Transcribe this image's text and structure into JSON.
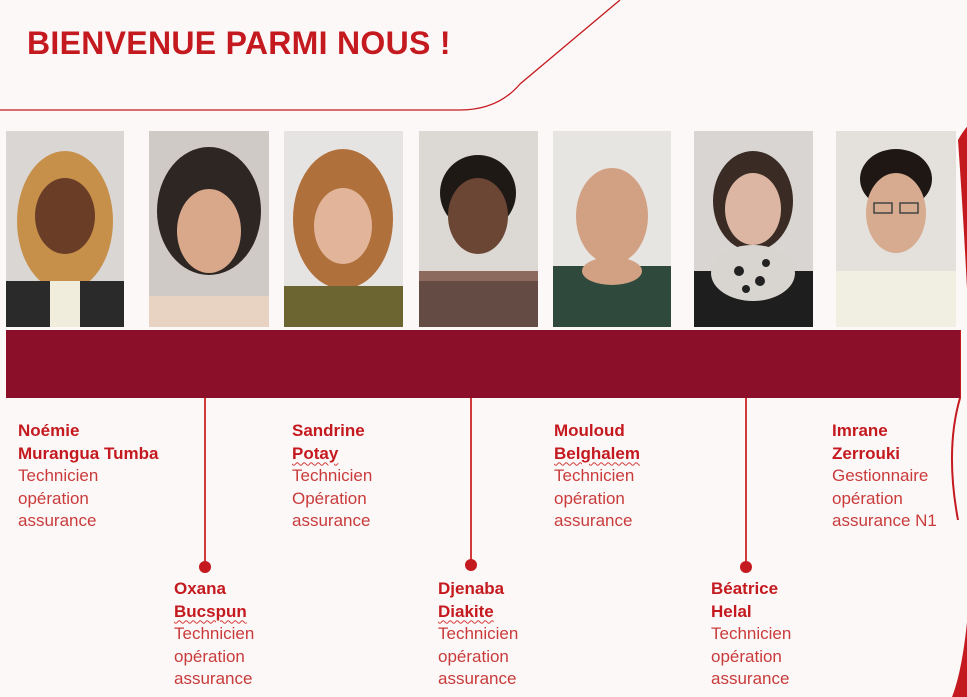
{
  "title": "BIENVENUE PARMI NOUS !",
  "colors": {
    "accent": "#c41a1f",
    "band": "#8b0f29",
    "text_role": "#c93b3b"
  },
  "people": [
    {
      "first_name": "Noémie",
      "last_name": "Murangua Tumba",
      "role": [
        "Technicien",
        "opération",
        "assurance"
      ]
    },
    {
      "first_name": "Oxana",
      "last_name": "Bucspun",
      "role": [
        "Technicien",
        "opération",
        "assurance"
      ]
    },
    {
      "first_name": "Sandrine",
      "last_name": "Potay",
      "role": [
        "Technicien",
        "Opération",
        "assurance"
      ]
    },
    {
      "first_name": "Djenaba",
      "last_name": "Diakite",
      "role": [
        "Technicien",
        "opération",
        "assurance"
      ]
    },
    {
      "first_name": "Mouloud",
      "last_name": "Belghalem",
      "role": [
        "Technicien",
        "opération",
        "assurance"
      ]
    },
    {
      "first_name": "Béatrice",
      "last_name": "Helal",
      "role": [
        "Technicien",
        "opération",
        "assurance"
      ]
    },
    {
      "first_name": "Imrane",
      "last_name": "Zerrouki",
      "role": [
        "Gestionnaire",
        "opération",
        "assurance N1"
      ]
    }
  ]
}
